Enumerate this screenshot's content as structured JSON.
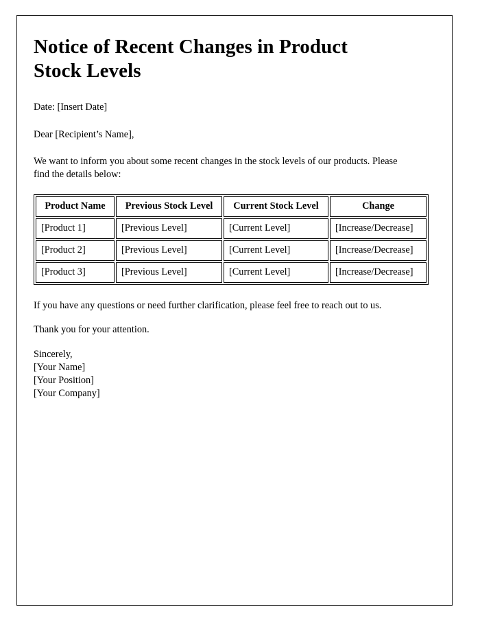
{
  "document": {
    "title": "Notice of Recent Changes in Product Stock Levels",
    "date_line": "Date: [Insert Date]",
    "salutation": "Dear [Recipient’s Name],",
    "intro_paragraph": "We want to inform you about some recent changes in the stock levels of our products. Please find the details below:",
    "closing_paragraph": "If you have any questions or need further clarification, please feel free to reach out to us.",
    "thanks_paragraph": "Thank you for your attention.",
    "signature": {
      "closing": "Sincerely,",
      "name": "[Your Name]",
      "position": "[Your Position]",
      "company": "[Your Company]"
    }
  },
  "table": {
    "headers": [
      "Product Name",
      "Previous Stock Level",
      "Current Stock Level",
      "Change"
    ],
    "rows": [
      {
        "product": "[Product 1]",
        "previous": "[Previous Level]",
        "current": "[Current Level]",
        "change": "[Increase/Decrease]"
      },
      {
        "product": "[Product 2]",
        "previous": "[Previous Level]",
        "current": "[Current Level]",
        "change": "[Increase/Decrease]"
      },
      {
        "product": "[Product 3]",
        "previous": "[Previous Level]",
        "current": "[Current Level]",
        "change": "[Increase/Decrease]"
      }
    ]
  },
  "colors": {
    "text": "#000000",
    "page_border": "#1a1a1a",
    "table_border": "#000000",
    "background": "#ffffff"
  }
}
